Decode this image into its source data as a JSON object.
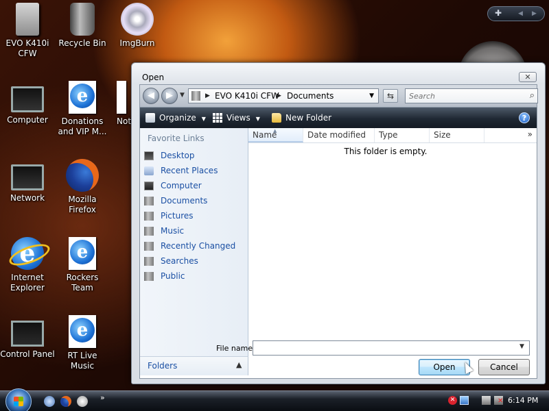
{
  "desktop": {
    "icons": [
      {
        "label": "EVO K410i CFW"
      },
      {
        "label": "Recycle Bin"
      },
      {
        "label": "ImgBurn"
      },
      {
        "label": "Computer"
      },
      {
        "label": "Donations and VIP M..."
      },
      {
        "label": "Not"
      },
      {
        "label": "Network"
      },
      {
        "label": "Mozilla Firefox"
      },
      {
        "label": "Internet Explorer"
      },
      {
        "label": "Rockers Team"
      },
      {
        "label": "Control Panel"
      },
      {
        "label": "RT Live Music"
      }
    ]
  },
  "dialog": {
    "title": "Open",
    "close_glyph": "✕",
    "address": {
      "crumbs": [
        "EVO K410i CFW",
        "Documents"
      ]
    },
    "search": {
      "placeholder": "Search"
    },
    "toolbar": {
      "organize": "Organize",
      "views": "Views",
      "new_folder": "New Folder",
      "help_glyph": "?"
    },
    "nav": {
      "heading": "Favorite Links",
      "links": [
        {
          "label": "Desktop",
          "icon": "desktop-icon"
        },
        {
          "label": "Recent Places",
          "icon": "recent-places-icon"
        },
        {
          "label": "Computer",
          "icon": "computer-icon"
        },
        {
          "label": "Documents",
          "icon": "documents-folder-icon"
        },
        {
          "label": "Pictures",
          "icon": "pictures-folder-icon"
        },
        {
          "label": "Music",
          "icon": "music-folder-icon"
        },
        {
          "label": "Recently Changed",
          "icon": "recently-changed-folder-icon"
        },
        {
          "label": "Searches",
          "icon": "searches-folder-icon"
        },
        {
          "label": "Public",
          "icon": "public-folder-icon"
        }
      ],
      "folders_label": "Folders"
    },
    "columns": [
      "Name",
      "Date modified",
      "Type",
      "Size"
    ],
    "empty_message": "This folder is empty.",
    "file_name_label": "File name:",
    "file_name_value": "",
    "open_label": "Open",
    "cancel_label": "Cancel"
  },
  "taskbar": {
    "clock": "6:14 PM"
  }
}
